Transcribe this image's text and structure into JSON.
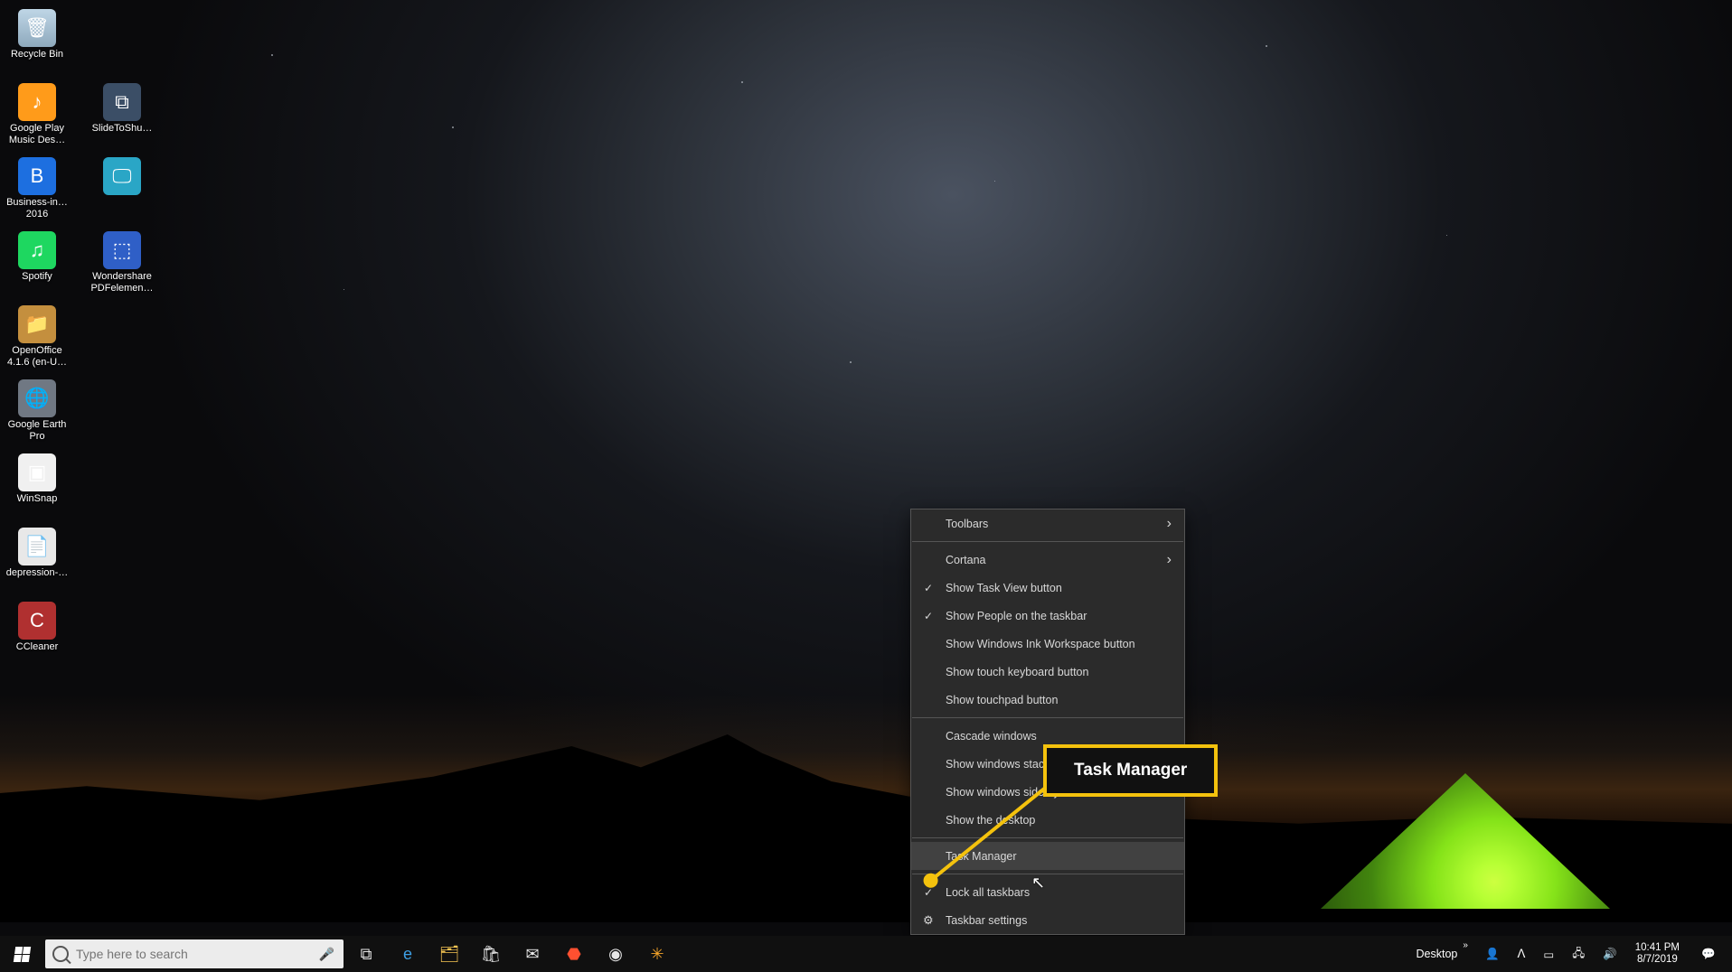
{
  "desktop_icons": {
    "col1": [
      {
        "name": "recycle-bin",
        "label": "Recycle Bin",
        "glyph": "🗑",
        "cls": "g-recycle"
      },
      {
        "name": "google-play-music",
        "label": "Google Play Music Des…",
        "glyph": "♪",
        "cls": "g-orange"
      },
      {
        "name": "business-in-a-box",
        "label": "Business-in… 2016",
        "glyph": "B",
        "cls": "g-blue"
      },
      {
        "name": "spotify",
        "label": "Spotify",
        "glyph": "♫",
        "cls": "g-green"
      },
      {
        "name": "openoffice",
        "label": "OpenOffice 4.1.6 (en-U…",
        "glyph": "📁",
        "cls": "g-folder"
      },
      {
        "name": "google-earth-pro",
        "label": "Google Earth Pro",
        "glyph": "🌐",
        "cls": "g-gray"
      },
      {
        "name": "winsnap",
        "label": "WinSnap",
        "glyph": "▣",
        "cls": "g-snap"
      },
      {
        "name": "depression-doc",
        "label": "depression-…",
        "glyph": "📄",
        "cls": "g-file"
      },
      {
        "name": "ccleaner",
        "label": "CCleaner",
        "glyph": "C",
        "cls": "g-ccl"
      }
    ],
    "col2": [
      {
        "name": "slide-to-shutdown",
        "label": "SlideToShu…",
        "glyph": "⧉",
        "cls": "g-slide"
      },
      {
        "name": "control-panel-shortcut",
        "label": "",
        "glyph": "🖵",
        "cls": "g-teal"
      },
      {
        "name": "wondershare-pdf",
        "label": "Wondershare PDFelemen…",
        "glyph": "⬚",
        "cls": "g-pdf"
      }
    ]
  },
  "context_menu": {
    "items": [
      {
        "label": "Toolbars",
        "arrow": true
      },
      {
        "sep": true
      },
      {
        "label": "Cortana",
        "arrow": true
      },
      {
        "label": "Show Task View button",
        "check": true
      },
      {
        "label": "Show People on the taskbar",
        "check": true
      },
      {
        "label": "Show Windows Ink Workspace button"
      },
      {
        "label": "Show touch keyboard button"
      },
      {
        "label": "Show touchpad button"
      },
      {
        "sep": true
      },
      {
        "label": "Cascade windows"
      },
      {
        "label": "Show windows stacked"
      },
      {
        "label": "Show windows side by side"
      },
      {
        "label": "Show the desktop"
      },
      {
        "sep": true
      },
      {
        "label": "Task Manager",
        "hover": true
      },
      {
        "sep": true
      },
      {
        "label": "Lock all taskbars",
        "check": true
      },
      {
        "label": "Taskbar settings",
        "gear": true
      }
    ]
  },
  "callout": {
    "label": "Task Manager"
  },
  "taskbar": {
    "search_placeholder": "Type here to search",
    "desktop_label": "Desktop",
    "time": "10:41 PM",
    "date": "8/7/2019"
  }
}
